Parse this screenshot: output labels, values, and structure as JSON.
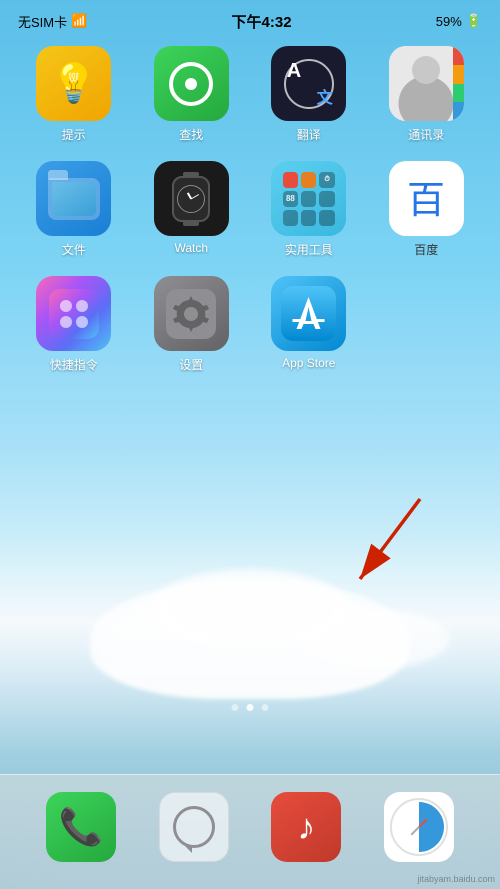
{
  "statusBar": {
    "carrier": "无SIM卡",
    "wifi": "wifi",
    "time": "下午4:32",
    "battery": "59%"
  },
  "apps": [
    {
      "id": "tips",
      "label": "提示",
      "row": 0,
      "col": 0
    },
    {
      "id": "find",
      "label": "查找",
      "row": 0,
      "col": 1
    },
    {
      "id": "translate",
      "label": "翻译",
      "row": 0,
      "col": 2
    },
    {
      "id": "contacts",
      "label": "通讯录",
      "row": 0,
      "col": 3
    },
    {
      "id": "files",
      "label": "文件",
      "row": 1,
      "col": 0
    },
    {
      "id": "watch",
      "label": "Watch",
      "row": 1,
      "col": 1
    },
    {
      "id": "utility",
      "label": "实用工具",
      "row": 1,
      "col": 2
    },
    {
      "id": "baidu",
      "label": "百度",
      "row": 1,
      "col": 3
    },
    {
      "id": "shortcuts",
      "label": "快捷指令",
      "row": 2,
      "col": 0
    },
    {
      "id": "settings",
      "label": "设置",
      "row": 2,
      "col": 1
    },
    {
      "id": "appstore",
      "label": "App Store",
      "row": 2,
      "col": 2
    }
  ],
  "dock": {
    "apps": [
      {
        "id": "phone",
        "label": "电话"
      },
      {
        "id": "message",
        "label": "信息"
      },
      {
        "id": "music",
        "label": "音乐"
      },
      {
        "id": "safari",
        "label": "Safari"
      }
    ]
  },
  "pageDots": [
    {
      "active": false
    },
    {
      "active": true
    },
    {
      "active": false
    }
  ]
}
